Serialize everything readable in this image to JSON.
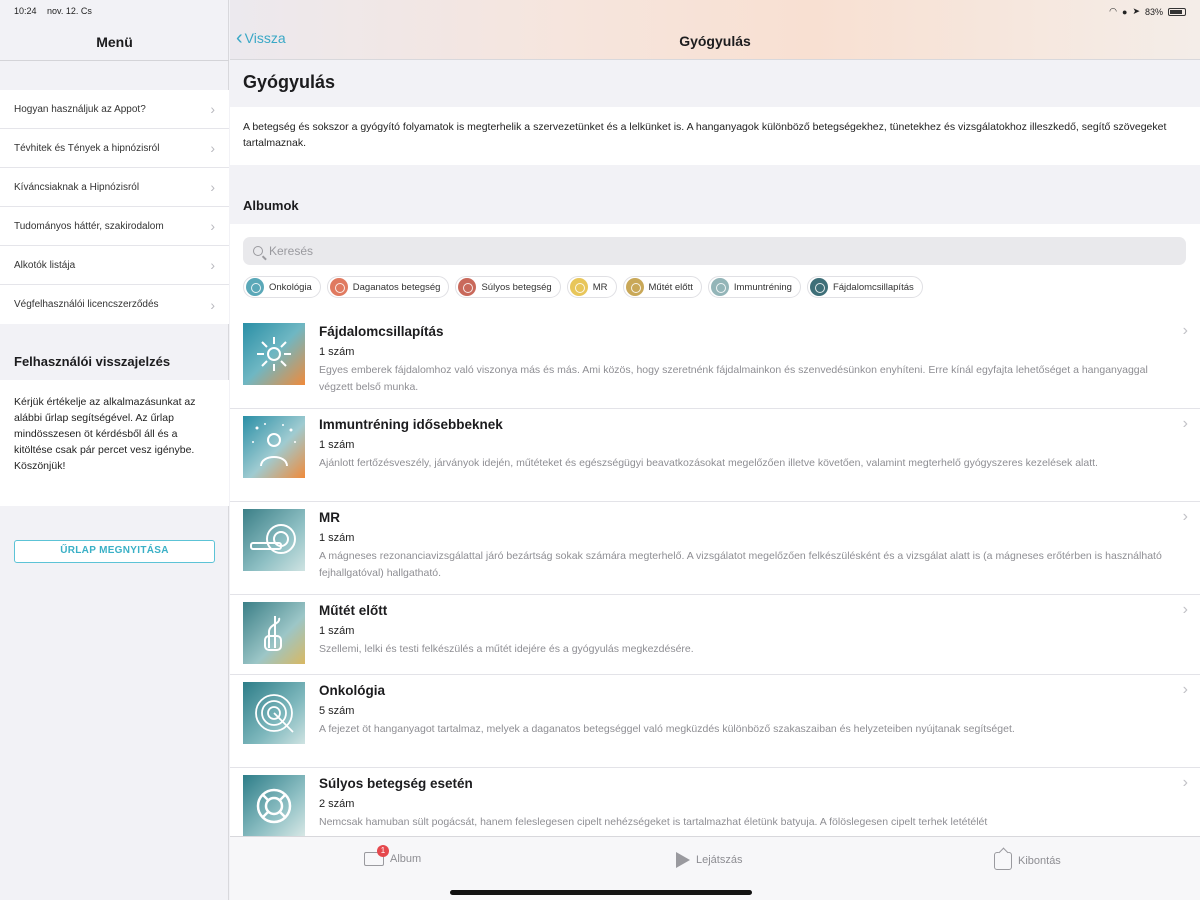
{
  "status": {
    "time": "10:24",
    "date": "nov. 12. Cs",
    "battery": "83%"
  },
  "sidebar": {
    "title": "Menü",
    "items": [
      {
        "label": "Hogyan használjuk az Appot?"
      },
      {
        "label": "Tévhitek és Tények a hipnózisról"
      },
      {
        "label": "Kíváncsiaknak a Hipnózisról"
      },
      {
        "label": "Tudományos háttér, szakirodalom"
      },
      {
        "label": "Alkotók listája"
      },
      {
        "label": "Végfelhasználói licencszerződés"
      }
    ],
    "feedback_title": "Felhasználói visszajelzés",
    "feedback_text": "Kérjük értékelje az alkalmazásunkat az alábbi űrlap segítségével. Az űrlap mindösszesen öt kérdésből áll és a kitöltése csak pár percet vesz igénybe. Köszönjük!",
    "feedback_button": "ŰRLAP MEGNYITÁSA"
  },
  "nav": {
    "back_label": "Vissza",
    "title": "Gyógyulás"
  },
  "main": {
    "page_title": "Gyógyulás",
    "description": "A betegség és sokszor a gyógyító folyamatok is megterhelik a szervezetünket és a lelkünket is. A hanganyagok különböző betegségekhez, tünetekhez és vizsgálatokhoz illeszkedő, segítő szövegeket tartalmaznak.",
    "section_title": "Albumok",
    "search_placeholder": "Keresés",
    "chips": [
      {
        "label": "Onkológia",
        "color": "#5aa8b8"
      },
      {
        "label": "Daganatos betegség",
        "color": "#e07a60"
      },
      {
        "label": "Súlyos betegség",
        "color": "#c9695b"
      },
      {
        "label": "MR",
        "color": "#e8c65a"
      },
      {
        "label": "Műtét előtt",
        "color": "#c9a858"
      },
      {
        "label": "Immuntréning",
        "color": "#93b5b8"
      },
      {
        "label": "Fájdalomcsillapítás",
        "color": "#3e6f78"
      }
    ],
    "albums": [
      {
        "name": "Fájdalomcsillapítás",
        "count": "1 szám",
        "desc": "Egyes emberek fájdalomhoz való viszonya más és más. Ami közös, hogy szeretnénk fájdalmainkon és szenvedésünkon enyhíteni. Erre kínál egyfajta lehetőséget a hanganyaggal végzett belső munka.",
        "icon": "sun-burst-icon"
      },
      {
        "name": "Immuntréning idősebbeknek",
        "count": "1 szám",
        "desc": "Ajánlott fertőzésveszély, járványok idején, műtéteket és egészségügyi beavatkozásokat megelőzően illetve követően, valamint megterhelő gyógyszeres kezelések alatt.",
        "icon": "person-sparkle-icon"
      },
      {
        "name": "MR",
        "count": "1 szám",
        "desc": "A mágneses rezonanciavizsgálattal járó bezártság sokak számára megterhelő. A vizsgálatot megelőzően felkészülésként és a vizsgálat alatt is (a mágneses erőtérben is használható fejhallgatóval) hallgatható.",
        "icon": "mri-scanner-icon"
      },
      {
        "name": "Műtét előtt",
        "count": "1 szám",
        "desc": "Szellemi, lelki és testi felkészülés a műtét idejére és a gyógyulás megkezdésére.",
        "icon": "crossed-fingers-icon"
      },
      {
        "name": "Onkológia",
        "count": "5 szám",
        "desc": "A fejezet öt hanganyagot tartalmaz, melyek a daganatos betegséggel való megküzdés különböző szakaszaiban és helyzeteiben nyújtanak segítséget.",
        "icon": "spiral-target-icon"
      },
      {
        "name": "Súlyos betegség esetén",
        "count": "2 szám",
        "desc": "Nemcsak hamuban sült pogácsát, hanem feleslegesen cipelt nehézségeket is tartalmazhat életünk batyuja. A fölöslegesen cipelt terhek letétélét",
        "icon": "life-buoy-icon"
      }
    ]
  },
  "toolbar": {
    "album_label": "Album",
    "album_badge": "1",
    "play_label": "Lejátszás",
    "expand_label": "Kibontás"
  }
}
